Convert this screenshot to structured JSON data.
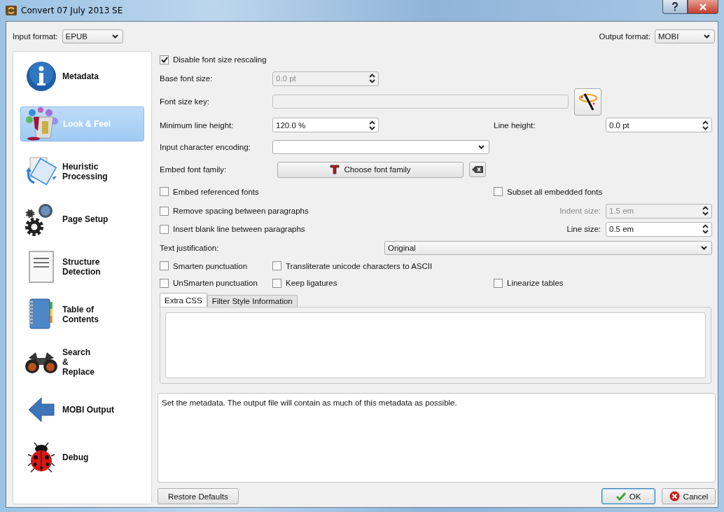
{
  "window": {
    "title": "Convert 07 July 2013 SE"
  },
  "input_format": {
    "label": "Input format:",
    "value": "EPUB"
  },
  "output_format": {
    "label": "Output format:",
    "value": "MOBI"
  },
  "sidebar": {
    "items": [
      {
        "label": "Metadata",
        "selected": false
      },
      {
        "label": "Look & Feel",
        "selected": true
      },
      {
        "label": "Heuristic\nProcessing",
        "selected": false
      },
      {
        "label": "Page Setup",
        "selected": false
      },
      {
        "label": "Structure\nDetection",
        "selected": false
      },
      {
        "label": "Table of\nContents",
        "selected": false
      },
      {
        "label": "Search\n&\nReplace",
        "selected": false
      },
      {
        "label": "MOBI Output",
        "selected": false
      },
      {
        "label": "Debug",
        "selected": false
      }
    ]
  },
  "look_and_feel": {
    "disable_font_size_rescaling": {
      "label": "Disable font size rescaling",
      "checked": true
    },
    "base_font_size": {
      "label": "Base font size:",
      "value": "0.0 pt",
      "disabled": true
    },
    "font_size_key": {
      "label": "Font size key:",
      "disabled": true
    },
    "minimum_line_height": {
      "label": "Minimum line height:",
      "value": "120.0 %",
      "disabled": false
    },
    "line_height": {
      "label": "Line height:",
      "value": "0.0 pt",
      "disabled": false
    },
    "input_character_encoding": {
      "label": "Input character encoding:"
    },
    "embed_font_family": {
      "label": "Embed font family:",
      "button": "Choose font family"
    },
    "embed_referenced_fonts": {
      "label": "Embed referenced fonts",
      "checked": false
    },
    "subset_all_embedded_fonts": {
      "label": "Subset all embedded fonts",
      "checked": false
    },
    "remove_spacing_between_paragraphs": {
      "label": "Remove spacing between paragraphs",
      "checked": false
    },
    "indent_size": {
      "label": "Indent size:",
      "value": "1.5 em",
      "disabled": true
    },
    "insert_blank_line_between_paragraphs": {
      "label": "Insert blank line between paragraphs",
      "checked": false
    },
    "line_size": {
      "label": "Line size:",
      "value": "0.5 em",
      "disabled": false
    },
    "text_justification": {
      "label": "Text justification:",
      "value": "Original"
    },
    "smarten_punctuation": {
      "label": "Smarten punctuation",
      "checked": false
    },
    "transliterate_unicode": {
      "label": "Transliterate unicode characters to ASCII",
      "checked": false
    },
    "unsmarten_punctuation": {
      "label": "UnSmarten punctuation",
      "checked": false
    },
    "keep_ligatures": {
      "label": "Keep ligatures",
      "checked": false
    },
    "linearize_tables": {
      "label": "Linearize tables",
      "checked": false
    }
  },
  "css_tabs": [
    {
      "label": "Extra CSS",
      "selected": true
    },
    {
      "label": "Filter Style Information",
      "selected": false
    }
  ],
  "help_text": "Set the metadata. The output file will contain as much of this metadata as possible.",
  "buttons": {
    "restore_defaults": "Restore Defaults",
    "ok": "OK",
    "cancel": "Cancel"
  }
}
